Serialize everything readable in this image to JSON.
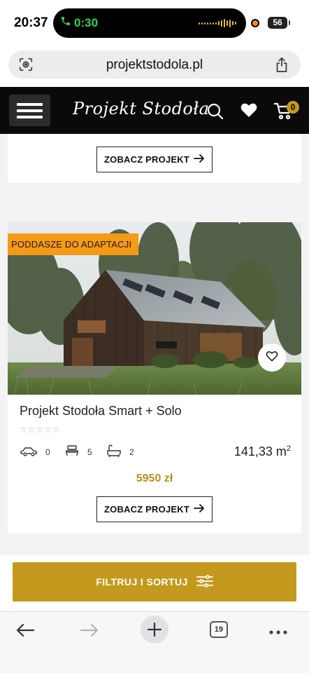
{
  "status_bar": {
    "time": "20:37",
    "call_timer": "0:30",
    "battery": "56",
    "accent_call": "#33d15a",
    "accent_rec": "#f28c1b"
  },
  "browser": {
    "url": "projektstodola.pl",
    "tabs_count": "19",
    "icons": [
      "reader-icon",
      "share-icon",
      "back-arrow-icon",
      "forward-arrow-icon",
      "plus-icon",
      "tabs-icon",
      "more-icon"
    ]
  },
  "site_header": {
    "logo": "Projekt Stodoła",
    "cart_count": "0",
    "brand_gold": "#c49a1e"
  },
  "top_card": {
    "button_label": "ZOBACZ PROJEKT"
  },
  "product": {
    "badge": "PODDASZE DO ADAPTACJI",
    "badge_color": "#f59a14",
    "title": "Projekt Stodoła Smart + Solo",
    "rating": 0,
    "rating_max": 5,
    "cars": "0",
    "bedrooms": "5",
    "bathrooms": "2",
    "area": "141,33 m",
    "area_sup": "2",
    "price": "5950 zł",
    "button_label": "ZOBACZ PROJEKT"
  },
  "filter": {
    "label": "FILTRUJ I SORTUJ"
  }
}
